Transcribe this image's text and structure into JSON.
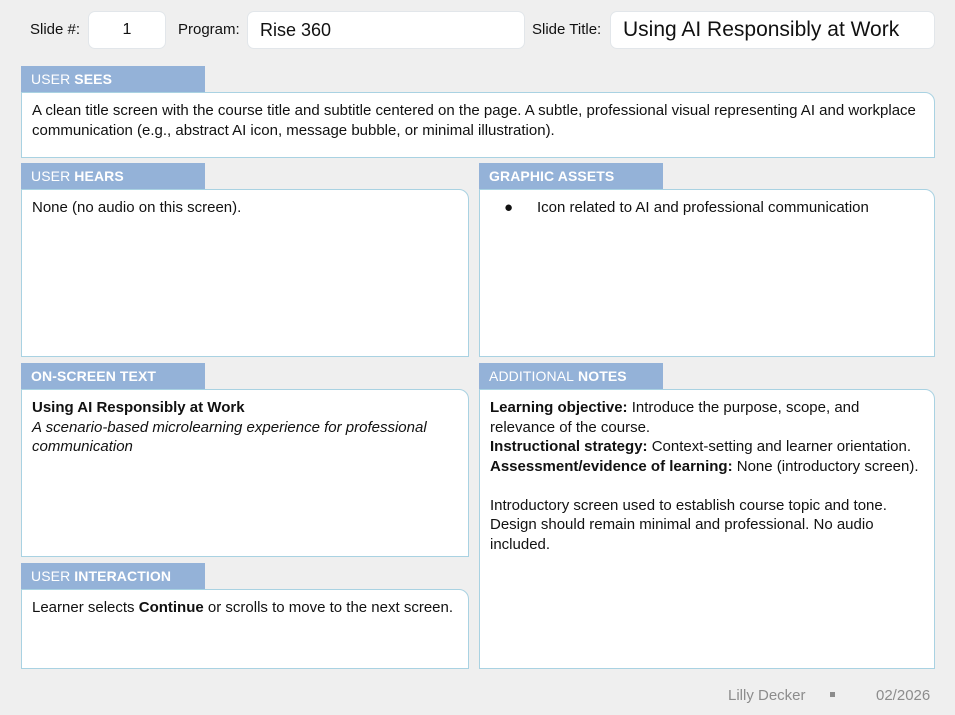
{
  "header": {
    "slide_label": "Slide #:",
    "slide_value": "1",
    "program_label": "Program:",
    "program_value": "Rise 360",
    "title_label": "Slide Title:",
    "title_value": "Using AI Responsibly at Work"
  },
  "user_sees": {
    "tab_plain": "USER",
    "tab_bold": "SEES",
    "text": "A clean title screen with the course title and subtitle centered on the page. A subtle, professional visual representing AI and workplace communication (e.g., abstract AI icon, message bubble, or minimal illustration)."
  },
  "user_hears": {
    "tab_plain": "USER",
    "tab_bold": "HEARS",
    "text": "None (no audio on this screen)."
  },
  "graphic_assets": {
    "tab_bold": "GRAPHIC ASSETS",
    "bullet": "●",
    "items": [
      "Icon related to AI and professional communication"
    ]
  },
  "on_screen_text": {
    "tab_bold": "ON-SCREEN TEXT",
    "title": "Using AI Responsibly at Work",
    "subtitle": "A scenario-based microlearning experience for professional communication"
  },
  "user_interaction": {
    "tab_plain": "USER",
    "tab_bold": "INTERACTION",
    "text_before": "Learner selects ",
    "text_bold": "Continue",
    "text_after": " or scrolls to move to the next screen."
  },
  "additional_notes": {
    "tab_plain": "ADDITIONAL",
    "tab_bold": "NOTES",
    "objective_label": "Learning objective:",
    "objective_text": " Introduce the purpose, scope, and relevance of the course.",
    "strategy_label": "Instructional strategy:",
    "strategy_text": " Context-setting and learner orientation.",
    "assessment_label": "Assessment/evidence of learning:",
    "assessment_text": " None (introductory screen).",
    "paragraph": "Introductory screen used to establish course topic and tone. Design should remain minimal and professional. No audio included."
  },
  "footer": {
    "author": "Lilly Decker",
    "date": "02/2026"
  },
  "colors": {
    "tab_bg": "#94b2d8",
    "box_border": "#a9d2e2",
    "page_bg": "#efefef"
  }
}
